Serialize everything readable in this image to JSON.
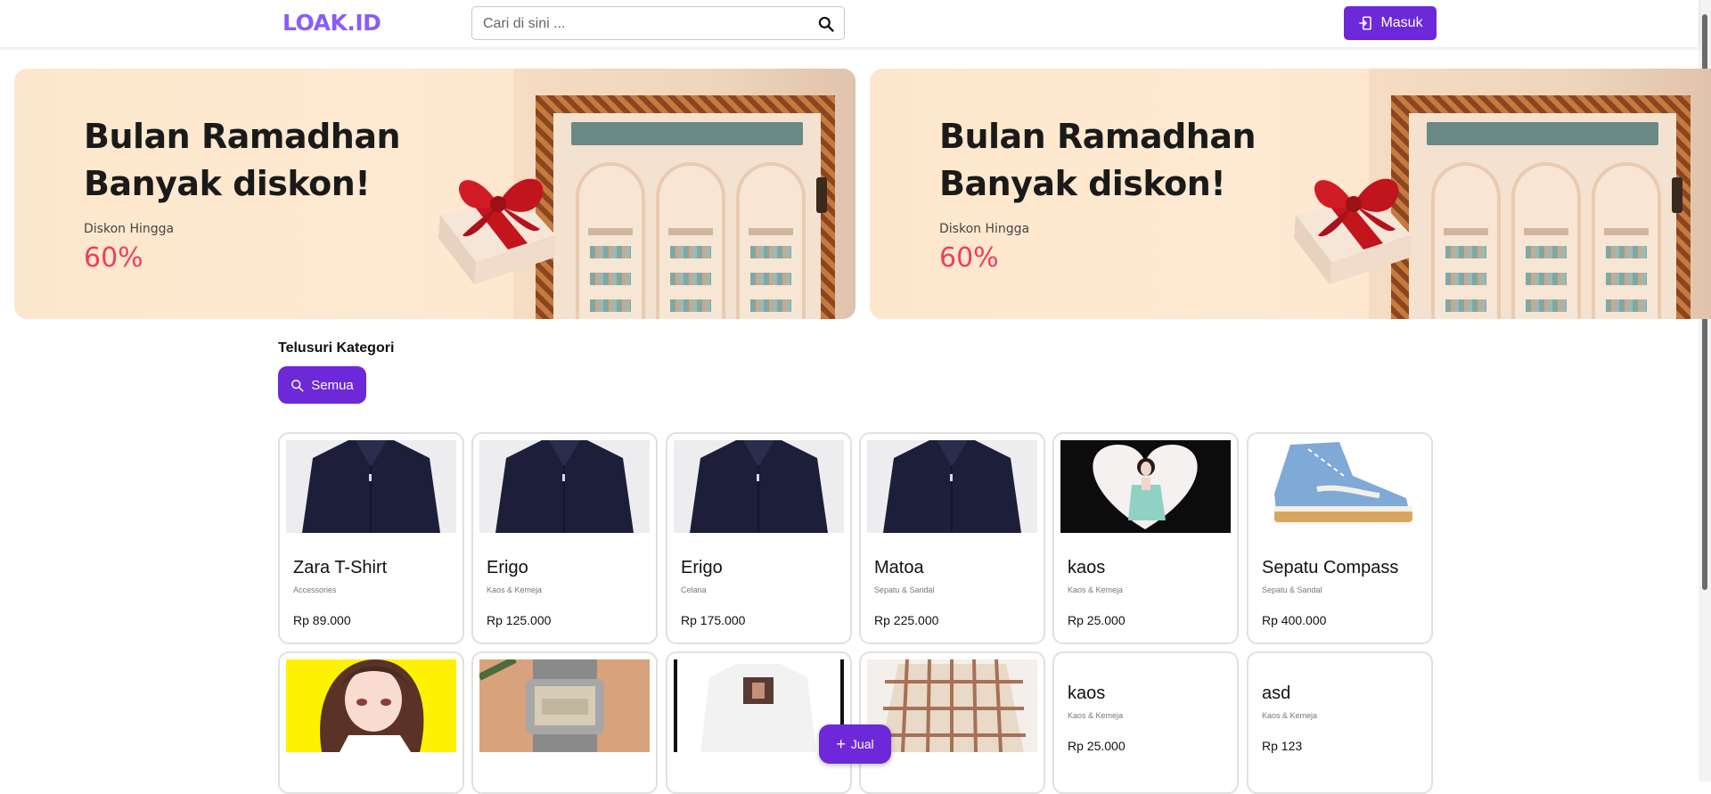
{
  "header": {
    "logo": "LOAK.ID",
    "search_placeholder": "Cari di sini ...",
    "login_label": "Masuk"
  },
  "banners": [
    {
      "title_line1": "Bulan Ramadhan",
      "title_line2": "Banyak diskon!",
      "subtitle": "Diskon Hingga",
      "percent": "60%"
    },
    {
      "title_line1": "Bulan Ramadhan",
      "title_line2": "Banyak diskon!",
      "subtitle": "Diskon Hingga",
      "percent": "60%"
    }
  ],
  "categories": {
    "title": "Telusuri Kategori",
    "button_label": "Semua"
  },
  "products": [
    {
      "name": "Zara T-Shirt",
      "category": "Accessories",
      "price": "Rp 89.000",
      "image": "navy-shirt"
    },
    {
      "name": "Erigo",
      "category": "Kaos & Kemeja",
      "price": "Rp 125.000",
      "image": "navy-shirt"
    },
    {
      "name": "Erigo",
      "category": "Celana",
      "price": "Rp 175.000",
      "image": "navy-shirt"
    },
    {
      "name": "Matoa",
      "category": "Sepatu & Sandal",
      "price": "Rp 225.000",
      "image": "navy-shirt"
    },
    {
      "name": "kaos",
      "category": "Kaos & Kemeja",
      "price": "Rp 25.000",
      "image": "heart-photo"
    },
    {
      "name": "Sepatu Compass",
      "category": "Sepatu & Sandal",
      "price": "Rp 400.000",
      "image": "blue-sneaker"
    },
    {
      "image": "anime-girl"
    },
    {
      "image": "digital-watch"
    },
    {
      "image": "white-hoodie"
    },
    {
      "image": "plaid-shirt"
    },
    {
      "name": "kaos",
      "category": "Kaos & Kemeja",
      "price": "Rp 25.000"
    },
    {
      "name": "asd",
      "category": "Kaos & Kemeja",
      "price": "Rp 123"
    }
  ],
  "fab": {
    "label": "Jual"
  },
  "colors": {
    "accent": "#6d28d9",
    "logo": "#8b5cf6",
    "discount": "#ef3d5f"
  }
}
